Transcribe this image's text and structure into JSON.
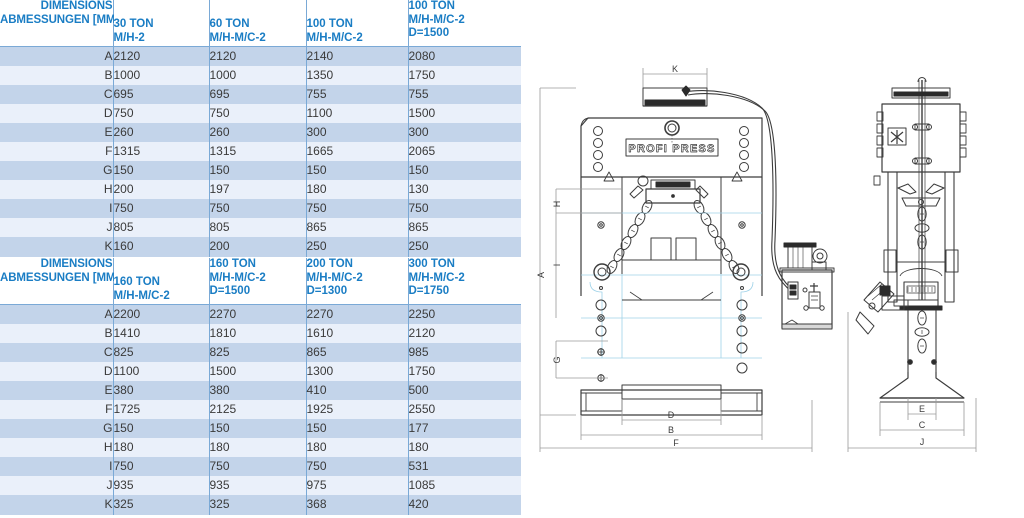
{
  "tables": [
    {
      "id": "table-1",
      "header": {
        "label_line1": "DIMENSIONS",
        "label_line2": "ABMESSUNGEN [MM]",
        "columns": [
          {
            "line1": "30 TON",
            "line2": "M/H-2",
            "line3": ""
          },
          {
            "line1": "60 TON",
            "line2": "M/H-M/C-2",
            "line3": ""
          },
          {
            "line1": "100 TON",
            "line2": "M/H-M/C-2",
            "line3": ""
          },
          {
            "line1": "100 TON",
            "line2": "M/H-M/C-2",
            "line3": "D=1500"
          }
        ]
      },
      "rows": [
        {
          "label": "A",
          "values": [
            "2120",
            "2120",
            "2140",
            "2080"
          ]
        },
        {
          "label": "B",
          "values": [
            "1000",
            "1000",
            "1350",
            "1750"
          ]
        },
        {
          "label": "C",
          "values": [
            "695",
            "695",
            "755",
            "755"
          ]
        },
        {
          "label": "D",
          "values": [
            "750",
            "750",
            "1100",
            "1500"
          ]
        },
        {
          "label": "E",
          "values": [
            "260",
            "260",
            "300",
            "300"
          ]
        },
        {
          "label": "F",
          "values": [
            "1315",
            "1315",
            "1665",
            "2065"
          ]
        },
        {
          "label": "G",
          "values": [
            "150",
            "150",
            "150",
            "150"
          ]
        },
        {
          "label": "H",
          "values": [
            "200",
            "197",
            "180",
            "130"
          ]
        },
        {
          "label": "I",
          "values": [
            "750",
            "750",
            "750",
            "750"
          ]
        },
        {
          "label": "J",
          "values": [
            "805",
            "805",
            "865",
            "865"
          ]
        },
        {
          "label": "K",
          "values": [
            "160",
            "200",
            "250",
            "250"
          ]
        }
      ]
    },
    {
      "id": "table-2",
      "header": {
        "label_line1": "DIMENSIONS",
        "label_line2": "ABMESSUNGEN [MM]",
        "columns": [
          {
            "line1": "160 TON",
            "line2": "M/H-M/C-2",
            "line3": ""
          },
          {
            "line1": "160 TON",
            "line2": "M/H-M/C-2",
            "line3": "D=1500"
          },
          {
            "line1": "200 TON",
            "line2": "M/H-M/C-2",
            "line3": "D=1300"
          },
          {
            "line1": "300 TON",
            "line2": "M/H-M/C-2",
            "line3": "D=1750"
          }
        ]
      },
      "rows": [
        {
          "label": "A",
          "values": [
            "2200",
            "2270",
            "2270",
            "2250"
          ]
        },
        {
          "label": "B",
          "values": [
            "1410",
            "1810",
            "1610",
            "2120"
          ]
        },
        {
          "label": "C",
          "values": [
            "825",
            "825",
            "865",
            "985"
          ]
        },
        {
          "label": "D",
          "values": [
            "1100",
            "1500",
            "1300",
            "1750"
          ]
        },
        {
          "label": "E",
          "values": [
            "380",
            "380",
            "410",
            "500"
          ]
        },
        {
          "label": "F",
          "values": [
            "1725",
            "2125",
            "1925",
            "2550"
          ]
        },
        {
          "label": "G",
          "values": [
            "150",
            "150",
            "150",
            "177"
          ]
        },
        {
          "label": "H",
          "values": [
            "180",
            "180",
            "180",
            "180"
          ]
        },
        {
          "label": "I",
          "values": [
            "750",
            "750",
            "750",
            "531"
          ]
        },
        {
          "label": "J",
          "values": [
            "935",
            "935",
            "975",
            "1085"
          ]
        },
        {
          "label": "K",
          "values": [
            "325",
            "325",
            "368",
            "420"
          ]
        }
      ]
    }
  ],
  "drawings": {
    "front_view": {
      "brand_label": "PROFI PRESS",
      "dimension_labels": {
        "K": "K",
        "A": "A",
        "H": "H",
        "I": "I",
        "G": "G",
        "D": "D",
        "B": "B",
        "F": "F"
      }
    },
    "side_view": {
      "dimension_labels": {
        "E": "E",
        "C": "C",
        "J": "J"
      }
    }
  },
  "colors": {
    "header_text": "#1a7dc4",
    "row_odd_bg": "#c3d4ea",
    "row_even_bg": "#eaf0fa",
    "grid_line": "#7aa9d6",
    "body_text": "#3a3a3a",
    "drawing_line": "#3c3c3c",
    "drawing_hidden": "#9fd2e8"
  }
}
